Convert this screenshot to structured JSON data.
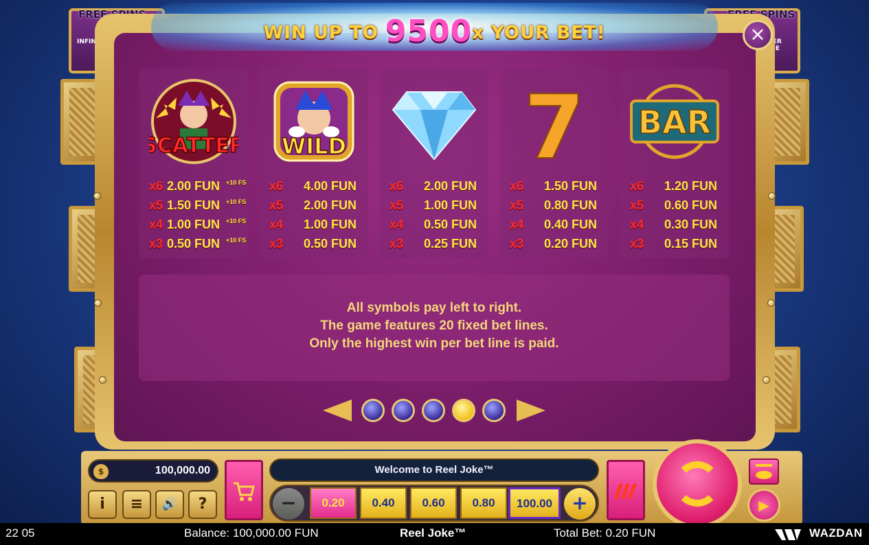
{
  "header": {
    "prefix": "WIN UP TO",
    "amount": "9500",
    "suffix": "x YOUR BET!"
  },
  "side_banners": {
    "left": {
      "title": "FREE SPINS",
      "text": "INFINITE INITIA"
    },
    "right": {
      "title": "FREE SPINS",
      "text": "PLIER ALUE"
    }
  },
  "close_label": "×",
  "symbols": [
    {
      "name": "SCATTER",
      "pays": [
        {
          "mult": "x6",
          "value": "2.00 FUN",
          "extra": "+10 FS"
        },
        {
          "mult": "x5",
          "value": "1.50 FUN",
          "extra": "+10 FS"
        },
        {
          "mult": "x4",
          "value": "1.00 FUN",
          "extra": "+10 FS"
        },
        {
          "mult": "x3",
          "value": "0.50 FUN",
          "extra": "+10 FS"
        }
      ]
    },
    {
      "name": "WILD",
      "pays": [
        {
          "mult": "x6",
          "value": "4.00 FUN"
        },
        {
          "mult": "x5",
          "value": "2.00 FUN"
        },
        {
          "mult": "x4",
          "value": "1.00 FUN"
        },
        {
          "mult": "x3",
          "value": "0.50 FUN"
        }
      ]
    },
    {
      "name": "diamond",
      "pays": [
        {
          "mult": "x6",
          "value": "2.00 FUN"
        },
        {
          "mult": "x5",
          "value": "1.00 FUN"
        },
        {
          "mult": "x4",
          "value": "0.50 FUN"
        },
        {
          "mult": "x3",
          "value": "0.25 FUN"
        }
      ]
    },
    {
      "name": "7",
      "pays": [
        {
          "mult": "x6",
          "value": "1.50 FUN"
        },
        {
          "mult": "x5",
          "value": "0.80 FUN"
        },
        {
          "mult": "x4",
          "value": "0.40 FUN"
        },
        {
          "mult": "x3",
          "value": "0.20 FUN"
        }
      ]
    },
    {
      "name": "BAR",
      "pays": [
        {
          "mult": "x6",
          "value": "1.20 FUN"
        },
        {
          "mult": "x5",
          "value": "0.60 FUN"
        },
        {
          "mult": "x4",
          "value": "0.30 FUN"
        },
        {
          "mult": "x3",
          "value": "0.15 FUN"
        }
      ]
    }
  ],
  "info_lines": [
    "All symbols pay left to right.",
    "The game features 20 fixed bet lines.",
    "Only the highest win per bet line is paid."
  ],
  "pager": {
    "total": 5,
    "active_index": 3
  },
  "controls": {
    "balance": "100,000.00",
    "info_btn": "i",
    "menu_btn": "≡",
    "sound_btn": "🔊",
    "help_btn": "?",
    "welcome_text": "Welcome to Reel Joke™",
    "bet_minus": "−",
    "bet_plus": "+",
    "bet_options": [
      "0.20",
      "0.40",
      "0.60",
      "0.80",
      "100.00"
    ],
    "selected_bet_index": 0
  },
  "status_bar": {
    "clock": "22 05",
    "balance": "Balance: 100,000.00 FUN",
    "game_name": "Reel Joke™",
    "total_bet": "Total Bet: 0.20 FUN",
    "brand": "WAZDAN"
  },
  "colors": {
    "panel_bg": "#7d1e6b",
    "gold": "#e8c46a",
    "pay_text": "#ffe545",
    "mult_text": "#ff2a2a",
    "active_dot": "#f2c019"
  }
}
